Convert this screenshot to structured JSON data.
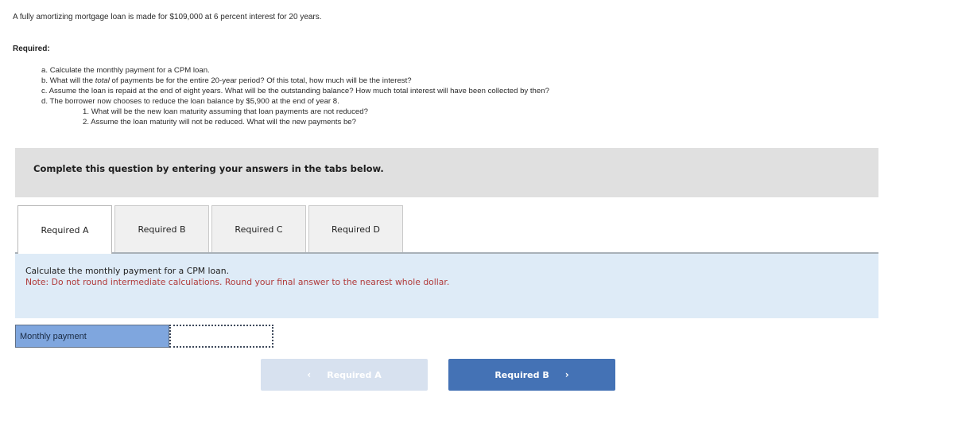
{
  "problem": {
    "intro": "A fully amortizing mortgage loan is made for $109,000 at 6 percent interest for 20 years.",
    "required_label": "Required:",
    "items": [
      {
        "prefix": "a.",
        "text": "Calculate the monthly payment for a CPM loan."
      },
      {
        "prefix": "b.",
        "text_before": "What will the ",
        "emph": "total",
        "text_after": " of payments be for the entire 20-year period? Of this total, how much will be the interest?"
      },
      {
        "prefix": "c.",
        "text": "Assume the loan is repaid at the end of eight years. What will be the outstanding balance? How much total interest will have been collected by then?"
      },
      {
        "prefix": "d.",
        "text": "The borrower now chooses to reduce the loan balance by $5,900 at the end of year 8."
      }
    ],
    "subitems": [
      {
        "prefix": "1.",
        "text": "What will be the new loan maturity assuming that loan payments are not reduced?"
      },
      {
        "prefix": "2.",
        "text": "Assume the loan maturity will not be reduced. What will the new payments be?"
      }
    ]
  },
  "banner": {
    "text": "Complete this question by entering your answers in the tabs below."
  },
  "tabs": [
    {
      "label": "Required A",
      "active": true
    },
    {
      "label": "Required B",
      "active": false
    },
    {
      "label": "Required C",
      "active": false
    },
    {
      "label": "Required D",
      "active": false
    }
  ],
  "panel": {
    "question": "Calculate the monthly payment for a CPM loan.",
    "note": "Note: Do not round intermediate calculations. Round your final answer to the nearest whole dollar."
  },
  "answer": {
    "label": "Monthly payment",
    "value": ""
  },
  "nav": {
    "prev_label": "Required A",
    "prev_icon": "‹",
    "next_label": "Required B",
    "next_icon": "›"
  },
  "colors": {
    "next_button": "#4472b5",
    "prev_button_disabled": "#d7e1ef",
    "panel_bg": "#deebf7",
    "note_text": "#b03a3a",
    "answer_label_bg": "#7fa6de"
  }
}
